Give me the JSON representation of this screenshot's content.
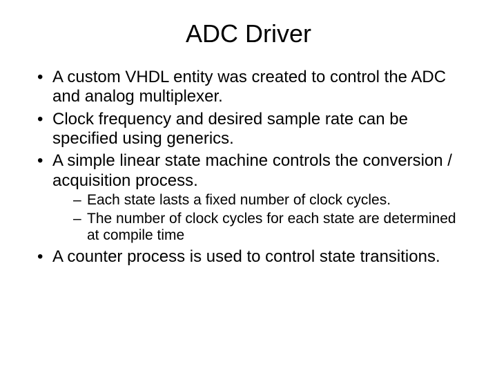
{
  "title": "ADC Driver",
  "bullets": [
    {
      "text": "A custom VHDL entity was created to control the ADC and analog multiplexer."
    },
    {
      "text": "Clock frequency and desired sample rate can be specified using generics."
    },
    {
      "text": "A simple linear state machine controls the conversion / acquisition process.",
      "sub": [
        "Each state lasts a fixed number of clock cycles.",
        "The number of clock cycles for each state are determined at compile time"
      ]
    },
    {
      "text": "A counter process is used to control state transitions."
    }
  ]
}
